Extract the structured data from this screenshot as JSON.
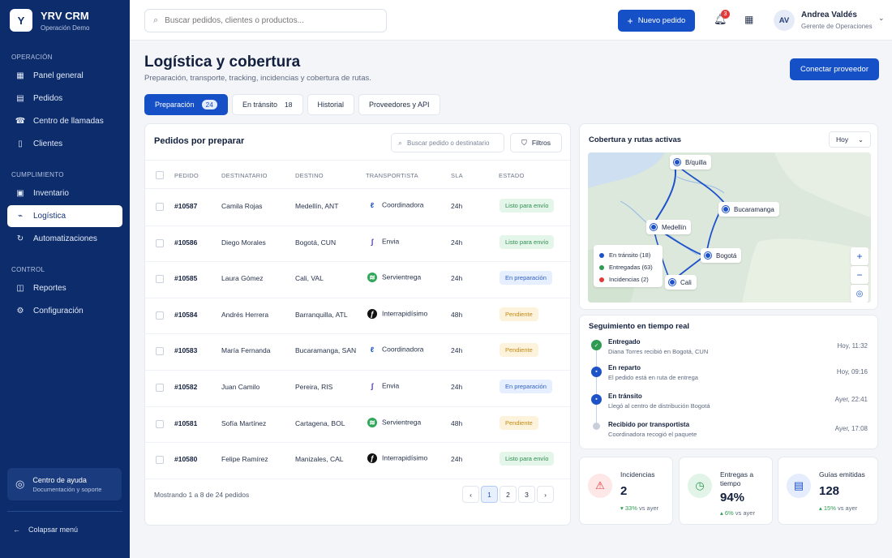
{
  "brand": {
    "logo_letter": "Y",
    "name": "YRV CRM",
    "subtitle": "Operación Demo"
  },
  "sidebar": {
    "sections": [
      {
        "title": "OPERACIÓN",
        "items": [
          {
            "label": "Panel general",
            "icon": "dashboard-icon"
          },
          {
            "label": "Pedidos",
            "icon": "orders-icon"
          },
          {
            "label": "Centro de llamadas",
            "icon": "phone-icon"
          },
          {
            "label": "Clientes",
            "icon": "clients-icon"
          }
        ]
      },
      {
        "title": "CUMPLIMIENTO",
        "items": [
          {
            "label": "Inventario",
            "icon": "inventory-icon"
          },
          {
            "label": "Logística",
            "icon": "logistics-icon",
            "active": true
          },
          {
            "label": "Automatizaciones",
            "icon": "automation-icon"
          }
        ]
      },
      {
        "title": "CONTROL",
        "items": [
          {
            "label": "Reportes",
            "icon": "reports-icon"
          },
          {
            "label": "Configuración",
            "icon": "settings-icon"
          }
        ]
      }
    ],
    "help": {
      "title": "Centro de ayuda",
      "subtitle": "Documentación y soporte"
    },
    "collapse_label": "Colapsar menú"
  },
  "topbar": {
    "search_placeholder": "Buscar pedidos, clientes o productos...",
    "new_order_label": "Nuevo pedido",
    "notifications_count": "3",
    "user": {
      "initials": "AV",
      "name": "Andrea Valdés",
      "role": "Gerente de Operaciones"
    }
  },
  "page": {
    "title": "Logística y cobertura",
    "subtitle": "Preparación, transporte, tracking, incidencias y cobertura de rutas.",
    "connect_label": "Conectar proveedor"
  },
  "tabs": [
    {
      "label": "Preparación",
      "count": "24",
      "active": true
    },
    {
      "label": "En tránsito",
      "count": "18"
    },
    {
      "label": "Historial",
      "count": ""
    },
    {
      "label": "Proveedores y API",
      "count": ""
    }
  ],
  "orders": {
    "title": "Pedidos por preparar",
    "search_placeholder": "Buscar pedido o destinatario",
    "filters_label": "Filtros",
    "columns": [
      "PEDIDO",
      "DESTINATARIO",
      "DESTINO",
      "TRANSPORTISTA",
      "SLA",
      "ESTADO"
    ],
    "rows": [
      {
        "id": "#10587",
        "recipient": "Camila Rojas",
        "destination": "Medellín, ANT",
        "carrier": "Coordinadora",
        "sla": "24h",
        "status": "Listo para envío",
        "status_type": "green"
      },
      {
        "id": "#10586",
        "recipient": "Diego Morales",
        "destination": "Bogotá, CUN",
        "carrier": "Envia",
        "sla": "24h",
        "status": "Listo para envío",
        "status_type": "green"
      },
      {
        "id": "#10585",
        "recipient": "Laura Gómez",
        "destination": "Cali, VAL",
        "carrier": "Servientrega",
        "sla": "24h",
        "status": "En preparación",
        "status_type": "blue"
      },
      {
        "id": "#10584",
        "recipient": "Andrés Herrera",
        "destination": "Barranquilla, ATL",
        "carrier": "Interrapidísimo",
        "sla": "48h",
        "status": "Pendiente",
        "status_type": "yellow"
      },
      {
        "id": "#10583",
        "recipient": "María Fernanda",
        "destination": "Bucaramanga, SAN",
        "carrier": "Coordinadora",
        "sla": "24h",
        "status": "Pendiente",
        "status_type": "yellow"
      },
      {
        "id": "#10582",
        "recipient": "Juan Camilo",
        "destination": "Pereira, RIS",
        "carrier": "Envia",
        "sla": "24h",
        "status": "En preparación",
        "status_type": "blue"
      },
      {
        "id": "#10581",
        "recipient": "Sofía Martínez",
        "destination": "Cartagena, BOL",
        "carrier": "Servientrega",
        "sla": "48h",
        "status": "Pendiente",
        "status_type": "yellow"
      },
      {
        "id": "#10580",
        "recipient": "Felipe Ramírez",
        "destination": "Manizales, CAL",
        "carrier": "Interrapidísimo",
        "sla": "24h",
        "status": "Listo para envío",
        "status_type": "green"
      }
    ],
    "footer": "Mostrando 1 a 8 de 24 pedidos",
    "pages": [
      "1",
      "2",
      "3"
    ],
    "current_page": "1"
  },
  "coverage": {
    "title": "Cobertura y rutas activas",
    "period": "Hoy",
    "cities": [
      "B/quilla",
      "Bucaramanga",
      "Medellín",
      "Bogotá",
      "Cali"
    ],
    "legend": [
      {
        "label": "En tránsito (18)",
        "color": "#1d52c9"
      },
      {
        "label": "Entregadas (63)",
        "color": "#2f9a52"
      },
      {
        "label": "Incidencias (2)",
        "color": "#e03a3a"
      }
    ]
  },
  "tracking": {
    "title": "Seguimiento en tiempo real",
    "events": [
      {
        "title": "Entregado",
        "desc": "Diana Torres recibió en Bogotá, CUN",
        "time": "Hoy, 11:32",
        "icon": "check-icon"
      },
      {
        "title": "En reparto",
        "desc": "El pedido está en ruta de entrega",
        "time": "Hoy, 09:16",
        "icon": "truck-icon"
      },
      {
        "title": "En tránsito",
        "desc": "Llegó al centro de distribución Bogotá",
        "time": "Ayer, 22:41",
        "icon": "warehouse-icon"
      },
      {
        "title": "Recibido por transportista",
        "desc": "Coordinadora recogió el paquete",
        "time": "Ayer, 17:08",
        "icon": "dot-icon"
      }
    ]
  },
  "stats": [
    {
      "label": "Incidencias",
      "value": "2",
      "delta": "33%",
      "delta_suffix": "vs ayer",
      "direction": "down",
      "icon": "warning-icon"
    },
    {
      "label": "Entregas a tiempo",
      "value": "94%",
      "delta": "6%",
      "delta_suffix": "vs ayer",
      "direction": "up",
      "icon": "clock-icon"
    },
    {
      "label": "Guías emitidas",
      "value": "128",
      "delta": "15%",
      "delta_suffix": "vs ayer",
      "direction": "up",
      "icon": "document-icon"
    }
  ],
  "colors": {
    "primary": "#1550c6",
    "sidebar": "#0d2c6b",
    "success": "#2f9a52",
    "danger": "#e03a3a",
    "warning": "#c38a14"
  }
}
